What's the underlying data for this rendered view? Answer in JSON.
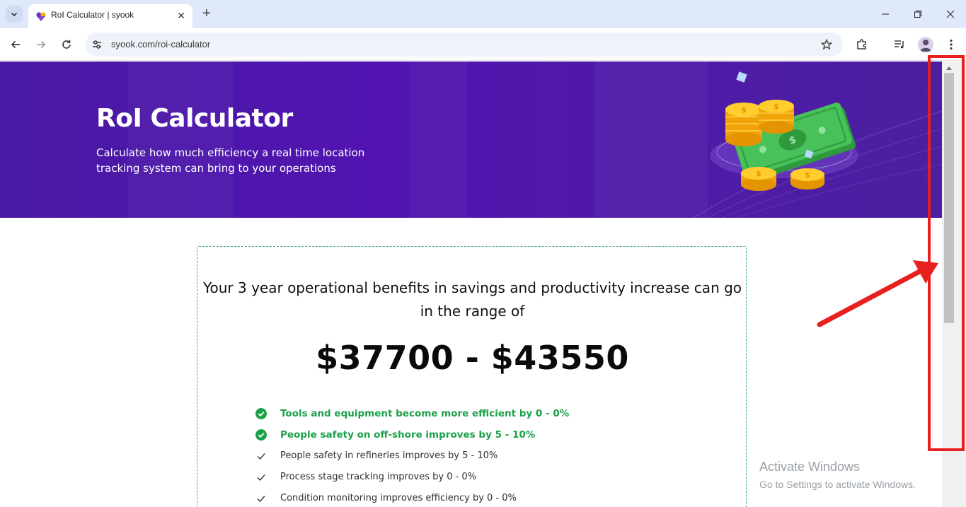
{
  "browser": {
    "tab": {
      "title": "RoI Calculator | syook",
      "favicon": "syook-logo-icon"
    },
    "new_tab_icon": "plus-icon",
    "address_bar": {
      "url": "syook.com/roi-calculator",
      "site_info_icon": "tune-icon"
    },
    "toolbar_icons": [
      "back-arrow-icon",
      "forward-arrow-icon",
      "reload-icon",
      "star-icon",
      "extensions-icon",
      "media-control-icon",
      "profile-avatar",
      "kebab-menu-icon"
    ],
    "window_controls": [
      "minimize-icon",
      "restore-icon",
      "close-icon"
    ]
  },
  "hero": {
    "title": "RoI Calculator",
    "subtitle": "Calculate how much efficiency a real time location tracking system can bring to your operations",
    "background_color": "#5114b0",
    "illustration": "coins-and-cash-illustration"
  },
  "result": {
    "heading": "Your 3 year operational benefits in savings and productivity increase can go in the range of",
    "range": "$37700 - $43550",
    "benefits": [
      {
        "text": "Tools and equipment become more efficient by 0 - 0%",
        "highlighted": true
      },
      {
        "text": "People safety on off-shore improves by 5 - 10%",
        "highlighted": true
      },
      {
        "text": "People safety in refineries improves by 5 - 10%",
        "highlighted": false
      },
      {
        "text": "Process stage tracking improves by 0 - 0%",
        "highlighted": false
      },
      {
        "text": "Condition monitoring improves efficiency by 0 - 0%",
        "highlighted": false
      }
    ],
    "highlight_color": "#1ca14a",
    "border_color": "#3aa86a"
  },
  "watermark": {
    "title": "Activate Windows",
    "subtitle": "Go to Settings to activate Windows."
  },
  "annotation": {
    "color": "#e8211f",
    "target": "scrollbar"
  }
}
